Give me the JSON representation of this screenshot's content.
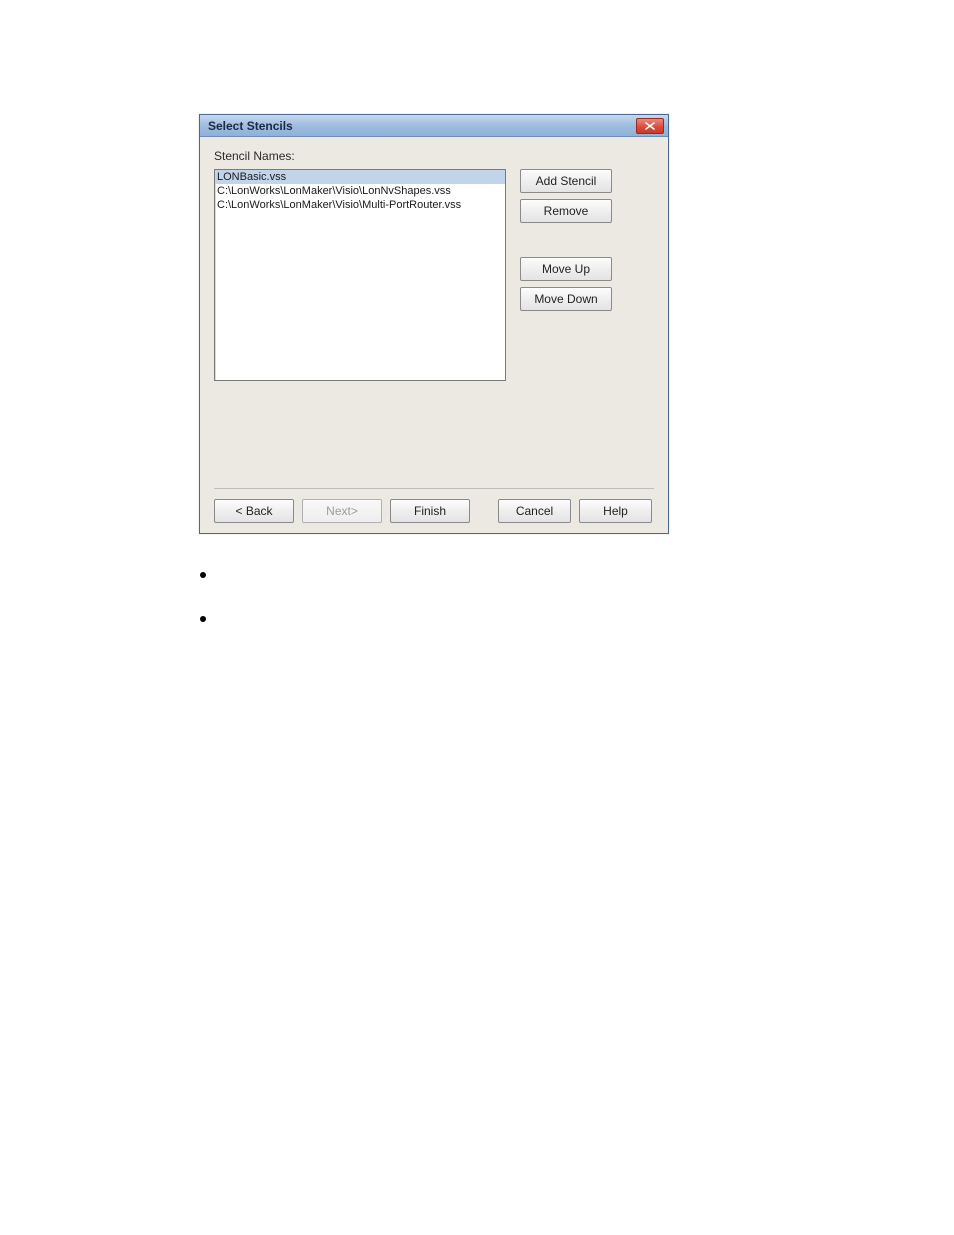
{
  "dialog": {
    "title": "Select Stencils",
    "label": "Stencil Names:",
    "items": [
      {
        "text": "LONBasic.vss",
        "selected": true
      },
      {
        "text": "C:\\LonWorks\\LonMaker\\Visio\\LonNvShapes.vss",
        "selected": false
      },
      {
        "text": "C:\\LonWorks\\LonMaker\\Visio\\Multi-PortRouter.vss",
        "selected": false
      }
    ],
    "buttons": {
      "add_stencil": "Add Stencil",
      "remove": "Remove",
      "move_up": "Move Up",
      "move_down": "Move Down"
    },
    "footer": {
      "back": "< Back",
      "next": "Next>",
      "finish": "Finish",
      "cancel": "Cancel",
      "help": "Help"
    }
  }
}
